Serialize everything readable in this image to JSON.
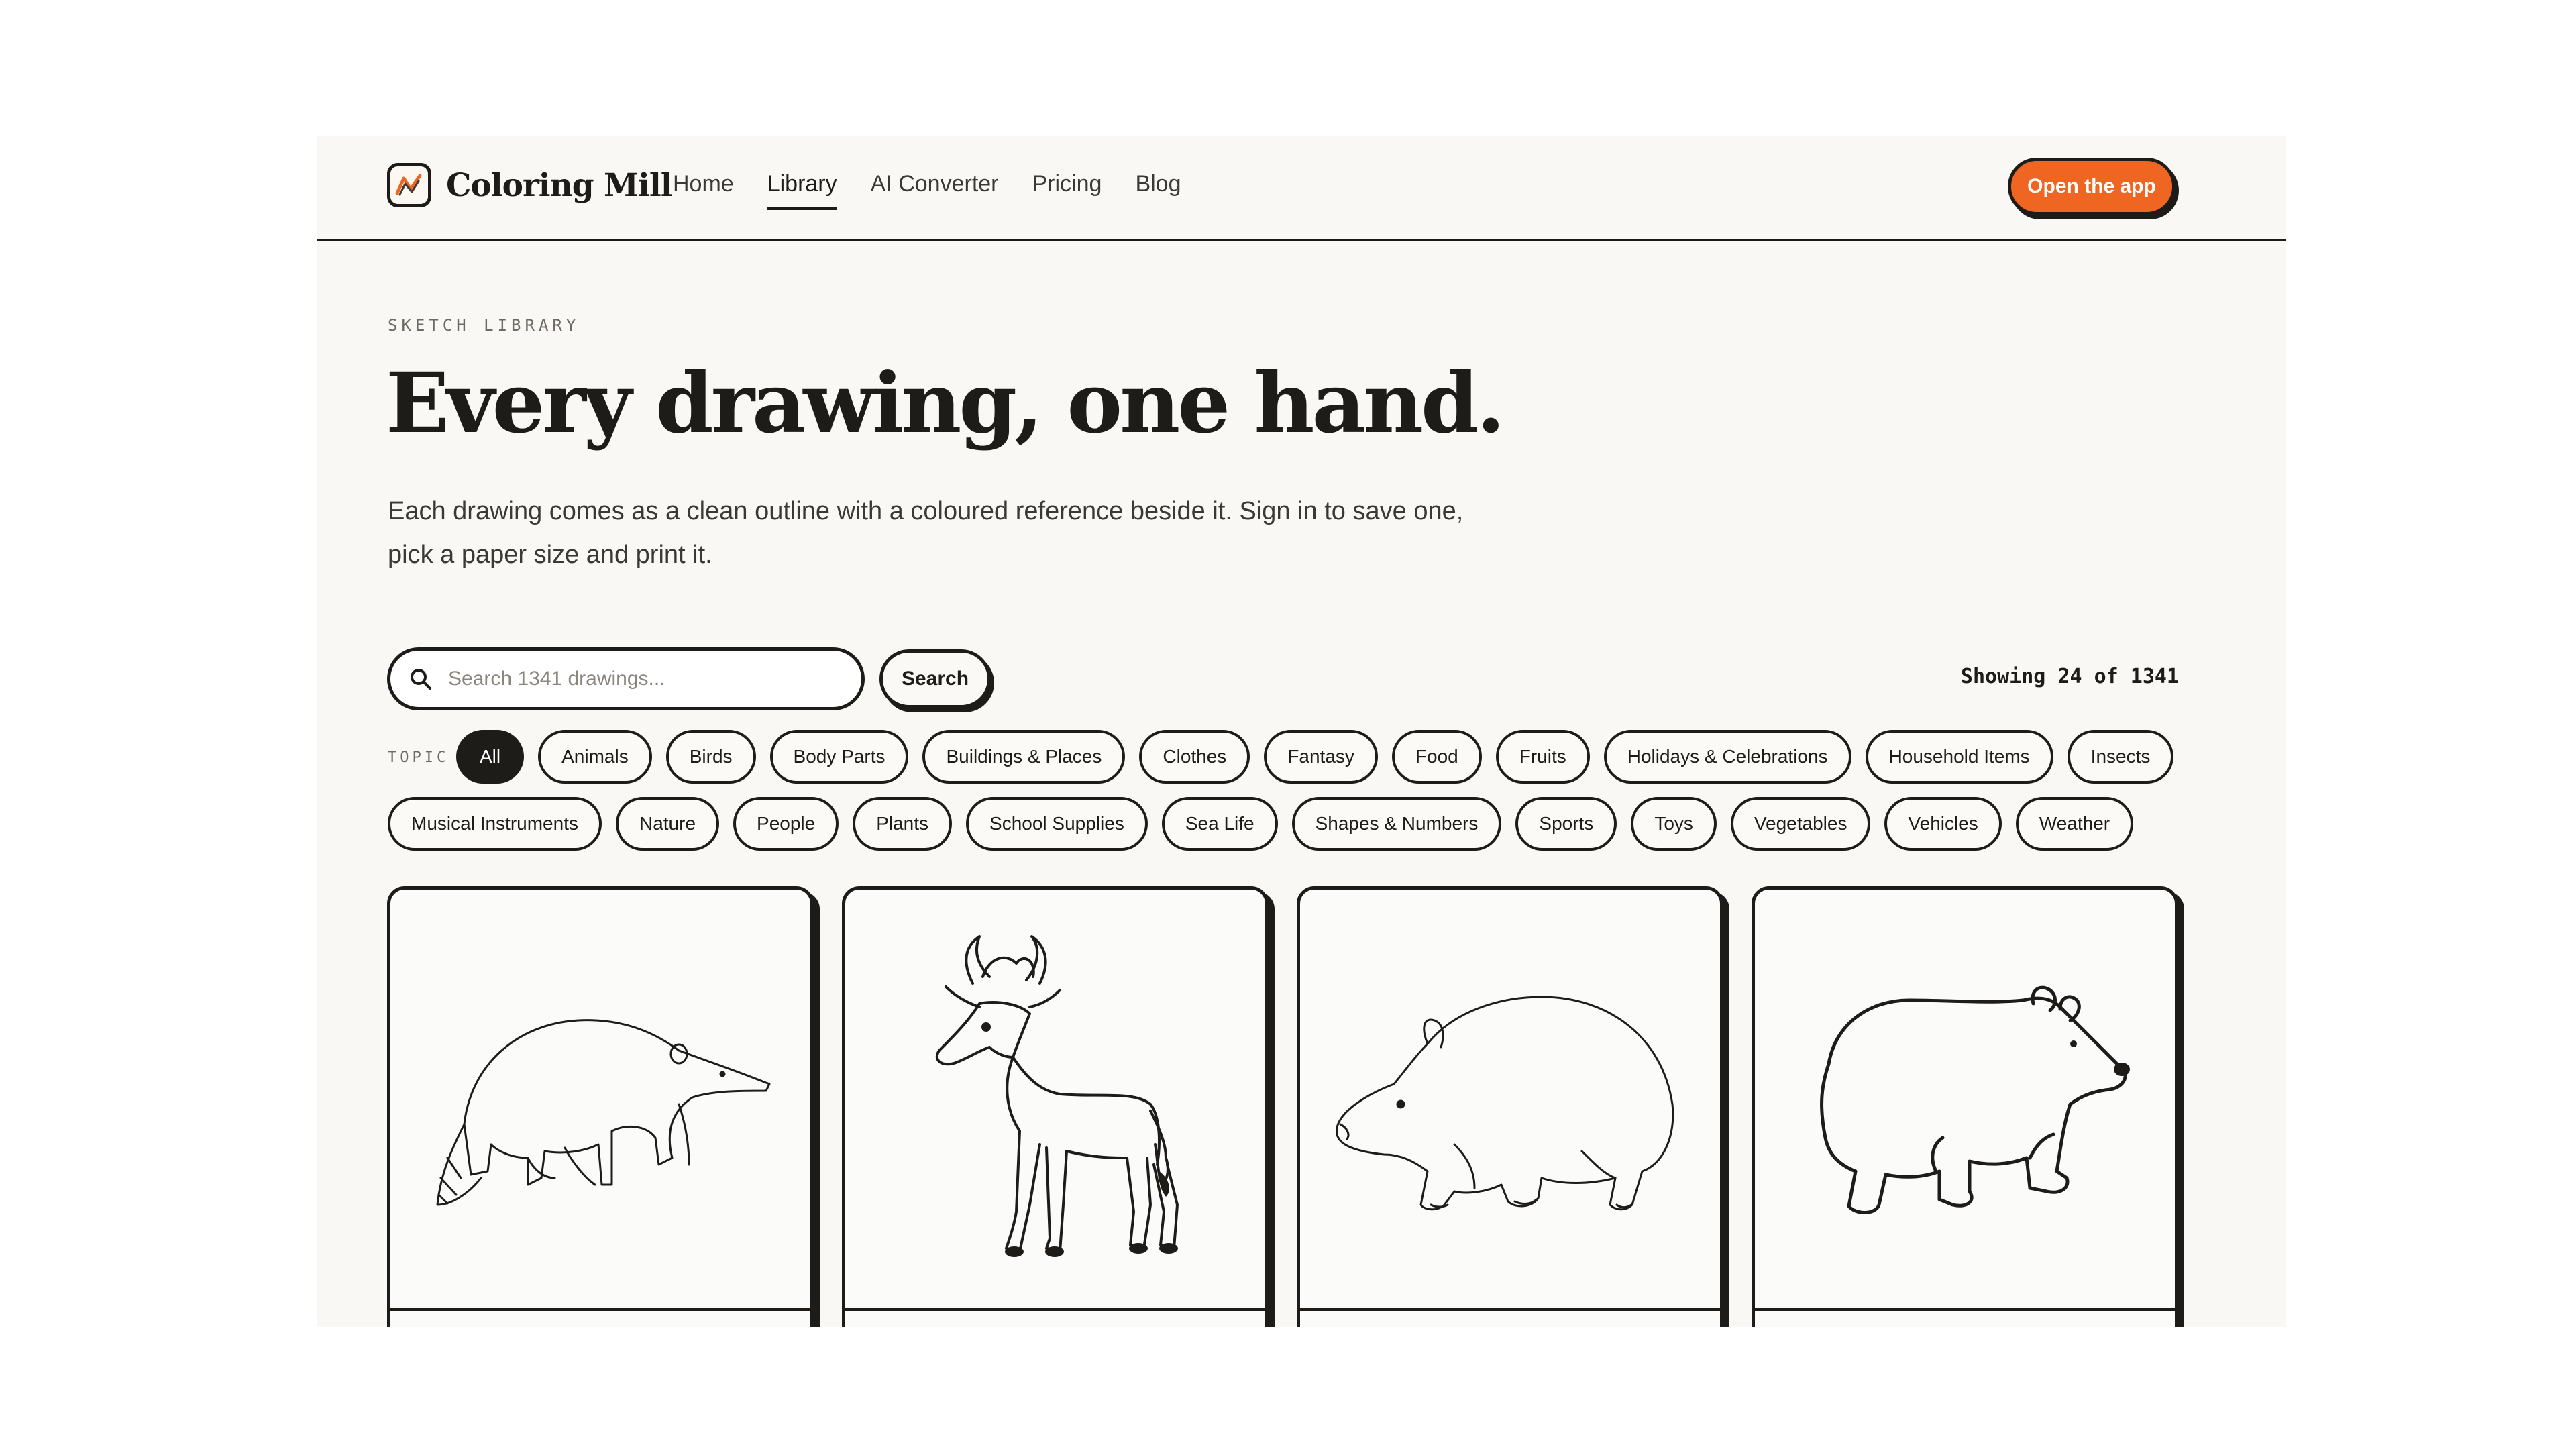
{
  "header": {
    "brand": "Coloring Mill",
    "nav": [
      {
        "label": "Home",
        "active": false
      },
      {
        "label": "Library",
        "active": true
      },
      {
        "label": "AI Converter",
        "active": false
      },
      {
        "label": "Pricing",
        "active": false
      },
      {
        "label": "Blog",
        "active": false
      }
    ],
    "cta_label": "Open the app",
    "accent_color": "#ee6621"
  },
  "hero": {
    "eyebrow": "SKETCH LIBRARY",
    "headline": "Every drawing, one hand.",
    "intro": "Each drawing comes as a clean outline with a coloured reference beside it. Sign in to save one, pick a paper size and print it."
  },
  "search": {
    "placeholder": "Search 1341 drawings...",
    "button_label": "Search",
    "showing": "Showing 24 of 1341"
  },
  "topics": {
    "label": "TOPIC",
    "row1": [
      "All",
      "Animals",
      "Birds",
      "Body Parts",
      "Buildings & Places",
      "Clothes",
      "Fantasy",
      "Food",
      "Fruits",
      "Holidays & Celebrations",
      "Household Items",
      "Insects"
    ],
    "row2": [
      "Musical Instruments",
      "Nature",
      "People",
      "Plants",
      "School Supplies",
      "Sea Life",
      "Shapes & Numbers",
      "Sports",
      "Toys",
      "Vegetables",
      "Vehicles",
      "Weather"
    ],
    "selected": "All"
  },
  "cards": [
    {
      "icon": "anteater-drawing-icon"
    },
    {
      "icon": "antelope-drawing-icon"
    },
    {
      "icon": "wombat-drawing-icon"
    },
    {
      "icon": "bear-cub-drawing-icon"
    }
  ]
}
